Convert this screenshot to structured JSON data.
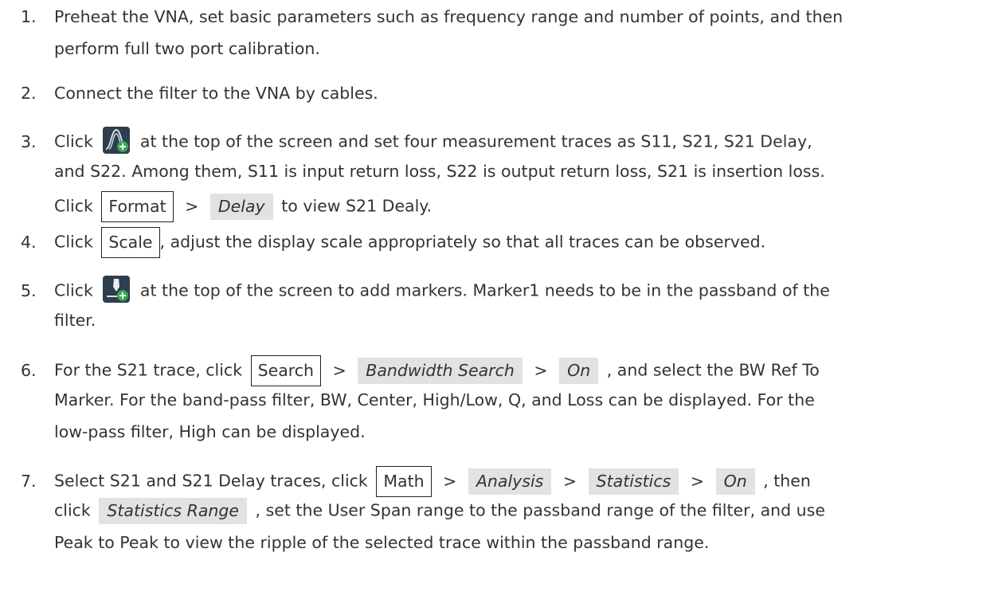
{
  "steps": [
    {
      "number": "1.",
      "lines": [
        "Preheat the VNA, set basic parameters such as frequency range and number of points, and then",
        "perform full two port calibration."
      ]
    },
    {
      "number": "2.",
      "lines": [
        "Connect the filter to the VNA by cables."
      ]
    },
    {
      "number": "3.",
      "line1_pre": "Click",
      "line1_post": "at the top of the screen and set four measurement traces as S11, S21, S21 Delay,",
      "icon": "trace-add-icon",
      "line2": "and S22. Among them, S11 is input return loss, S22 is output return loss, S21 is insertion loss.",
      "line3_pre": "Click",
      "format_label": "Format",
      "gt": ">",
      "delay_label": "Delay",
      "line3_post": "to view S21 Dealy."
    },
    {
      "number": "4.",
      "pre": "Click",
      "scale_label": "Scale",
      "post": ", adjust the display scale appropriately so that all traces can be observed."
    },
    {
      "number": "5.",
      "line1_pre": "Click",
      "icon": "marker-add-icon",
      "line1_post": "at the top of the screen to add markers. Marker1 needs to be in the passband of the",
      "line2": "filter."
    },
    {
      "number": "6.",
      "line1_pre": "For the S21 trace, click",
      "search_label": "Search",
      "bandwidth_label": "Bandwidth Search",
      "on_label": "On",
      "gt": ">",
      "line1_post": ", and select the BW Ref To",
      "line2": "Marker. For the band-pass filter, BW, Center, High/Low, Q, and Loss can be displayed. For the",
      "line3": "low-pass filter, High can be displayed."
    },
    {
      "number": "7.",
      "line1_pre": "Select S21 and S21 Delay traces, click",
      "math_label": "Math",
      "analysis_label": "Analysis",
      "statistics_label": "Statistics",
      "on_label": "On",
      "gt": ">",
      "line1_post": ", then",
      "line2_pre": "click",
      "stat_range_label": "Statistics Range",
      "line2_post": ", set the User Span range to the passband range of the filter, and use",
      "line3": "Peak to Peak to view the ripple of the selected trace within the passband range."
    }
  ],
  "colors": {
    "text": "#333333",
    "chip": "#e2e2e2",
    "icon_green": "#3aa657",
    "icon_dark": "#2d3e4e"
  }
}
